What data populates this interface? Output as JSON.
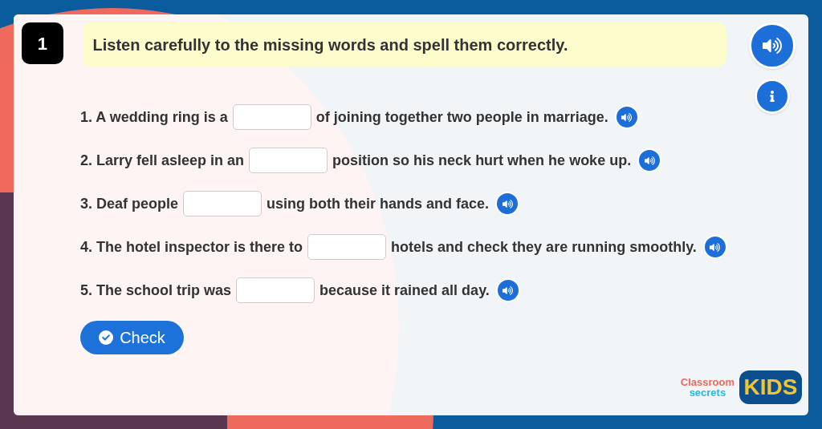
{
  "question": {
    "number": "1",
    "instruction": "Listen carefully to the missing words and spell them correctly."
  },
  "sentences": [
    {
      "before": "1. A wedding ring is a",
      "after": "of joining together two people in marriage."
    },
    {
      "before": "2. Larry fell asleep in an",
      "after": "position so his neck hurt when he woke up."
    },
    {
      "before": "3. Deaf people",
      "after": "using both their hands and face."
    },
    {
      "before": "4. The hotel inspector is there to",
      "after": "hotels and check they are running smoothly."
    },
    {
      "before": "5. The school trip was",
      "after": "because it rained all day."
    }
  ],
  "check_button": "Check",
  "logo": {
    "line1": "Classroom",
    "line2": "secrets",
    "badge": "KIDS"
  }
}
